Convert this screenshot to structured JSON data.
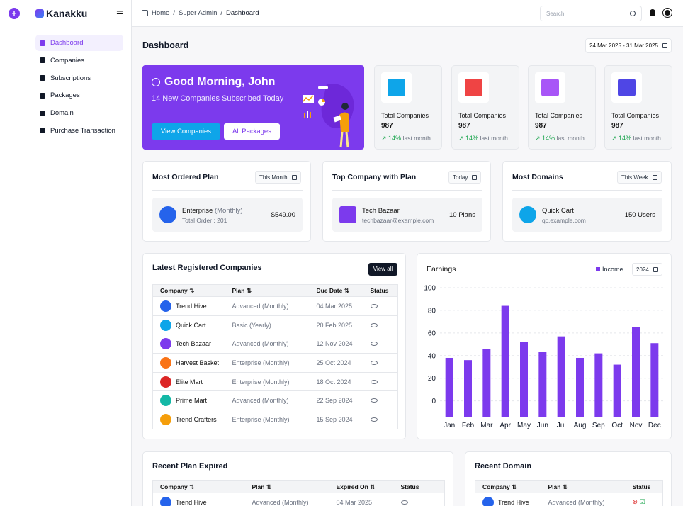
{
  "brand": {
    "name": "Kanakku"
  },
  "nav": [
    {
      "label": "Dashboard"
    },
    {
      "label": "Companies"
    },
    {
      "label": "Subscriptions"
    },
    {
      "label": "Packages"
    },
    {
      "label": "Domain"
    },
    {
      "label": "Purchase Transaction"
    }
  ],
  "breadcrumb": {
    "home": "Home",
    "mid": "Super Admin",
    "current": "Dashboard"
  },
  "search": {
    "placeholder": "Search"
  },
  "page": {
    "title": "Dashboard",
    "daterange": "24 Mar 2025 - 31 Mar 2025"
  },
  "hero": {
    "greeting": "Good Morning, John",
    "subtitle": "14 New Companies Subscribed Today",
    "btn_primary": "View Companies",
    "btn_secondary": "All Packages"
  },
  "stats": [
    {
      "label": "Total Companies",
      "value": "987",
      "trend": "14%",
      "note": "last month",
      "color": "#0ea5e9"
    },
    {
      "label": "Total Companies",
      "value": "987",
      "trend": "14%",
      "note": "last month",
      "color": "#ef4444"
    },
    {
      "label": "Total Companies",
      "value": "987",
      "trend": "14%",
      "note": "last month",
      "color": "#a855f7"
    },
    {
      "label": "Total Companies",
      "value": "987",
      "trend": "14%",
      "note": "last month",
      "color": "#4f46e5"
    }
  ],
  "widgets": {
    "ordered": {
      "title": "Most Ordered Plan",
      "filter": "This Month",
      "name": "Enterprise",
      "paren": "(Monthly)",
      "sub": "Total Order : 201",
      "value": "$549.00"
    },
    "topco": {
      "title": "Top Company with Plan",
      "filter": "Today",
      "name": "Tech Bazaar",
      "sub": "techbazaar@example.com",
      "value": "10 Plans"
    },
    "domains": {
      "title": "Most Domains",
      "filter": "This Week",
      "name": "Quick Cart",
      "sub": "qc.example.com",
      "value": "150 Users"
    }
  },
  "latest": {
    "title": "Latest Registered Companies",
    "view_all": "View all",
    "headers": [
      "Company",
      "Plan",
      "Due Date",
      "Status"
    ],
    "rows": [
      {
        "company": "Trend Hive",
        "plan": "Advanced (Monthly)",
        "date": "04 Mar 2025",
        "color": "#2563eb"
      },
      {
        "company": "Quick Cart",
        "plan": "Basic (Yearly)",
        "date": "20 Feb 2025",
        "color": "#0ea5e9"
      },
      {
        "company": "Tech Bazaar",
        "plan": "Advanced (Monthly)",
        "date": "12 Nov 2024",
        "color": "#7c3aed"
      },
      {
        "company": "Harvest Basket",
        "plan": "Enterprise (Monthly)",
        "date": "25 Oct 2024",
        "color": "#f97316"
      },
      {
        "company": "Elite Mart",
        "plan": "Enterprise (Monthly)",
        "date": "18 Oct 2024",
        "color": "#dc2626"
      },
      {
        "company": "Prime Mart",
        "plan": "Advanced (Monthly)",
        "date": "22 Sep 2024",
        "color": "#14b8a6"
      },
      {
        "company": "Trend Crafters",
        "plan": "Enterprise (Monthly)",
        "date": "15 Sep 2024",
        "color": "#f59e0b"
      }
    ]
  },
  "earnings": {
    "title": "Earnings",
    "legend": "Income",
    "year": "2024"
  },
  "chart_data": {
    "type": "bar",
    "categories": [
      "Jan",
      "Feb",
      "Mar",
      "Apr",
      "May",
      "Jun",
      "Jul",
      "Aug",
      "Sep",
      "Oct",
      "Nov",
      "Dec"
    ],
    "series": [
      {
        "name": "Income",
        "values": [
          38,
          36,
          46,
          84,
          52,
          43,
          57,
          38,
          42,
          32,
          65,
          51
        ],
        "color": "#7c3aed"
      }
    ],
    "yticks": [
      "100",
      "80",
      "60",
      "40",
      "20",
      "0"
    ],
    "ylim": [
      -14,
      100
    ]
  },
  "expired": {
    "title": "Recent Plan Expired",
    "headers": [
      "Company",
      "Plan",
      "Expired On",
      "Status"
    ],
    "row": {
      "company": "Trend Hive",
      "plan": "Advanced (Monthly)",
      "date": "04 Mar 2025"
    }
  },
  "domain": {
    "title": "Recent Domain",
    "headers": [
      "Company",
      "Plan",
      "Status"
    ],
    "row": {
      "company": "Trend Hive",
      "plan": "Advanced (Monthly)"
    }
  }
}
